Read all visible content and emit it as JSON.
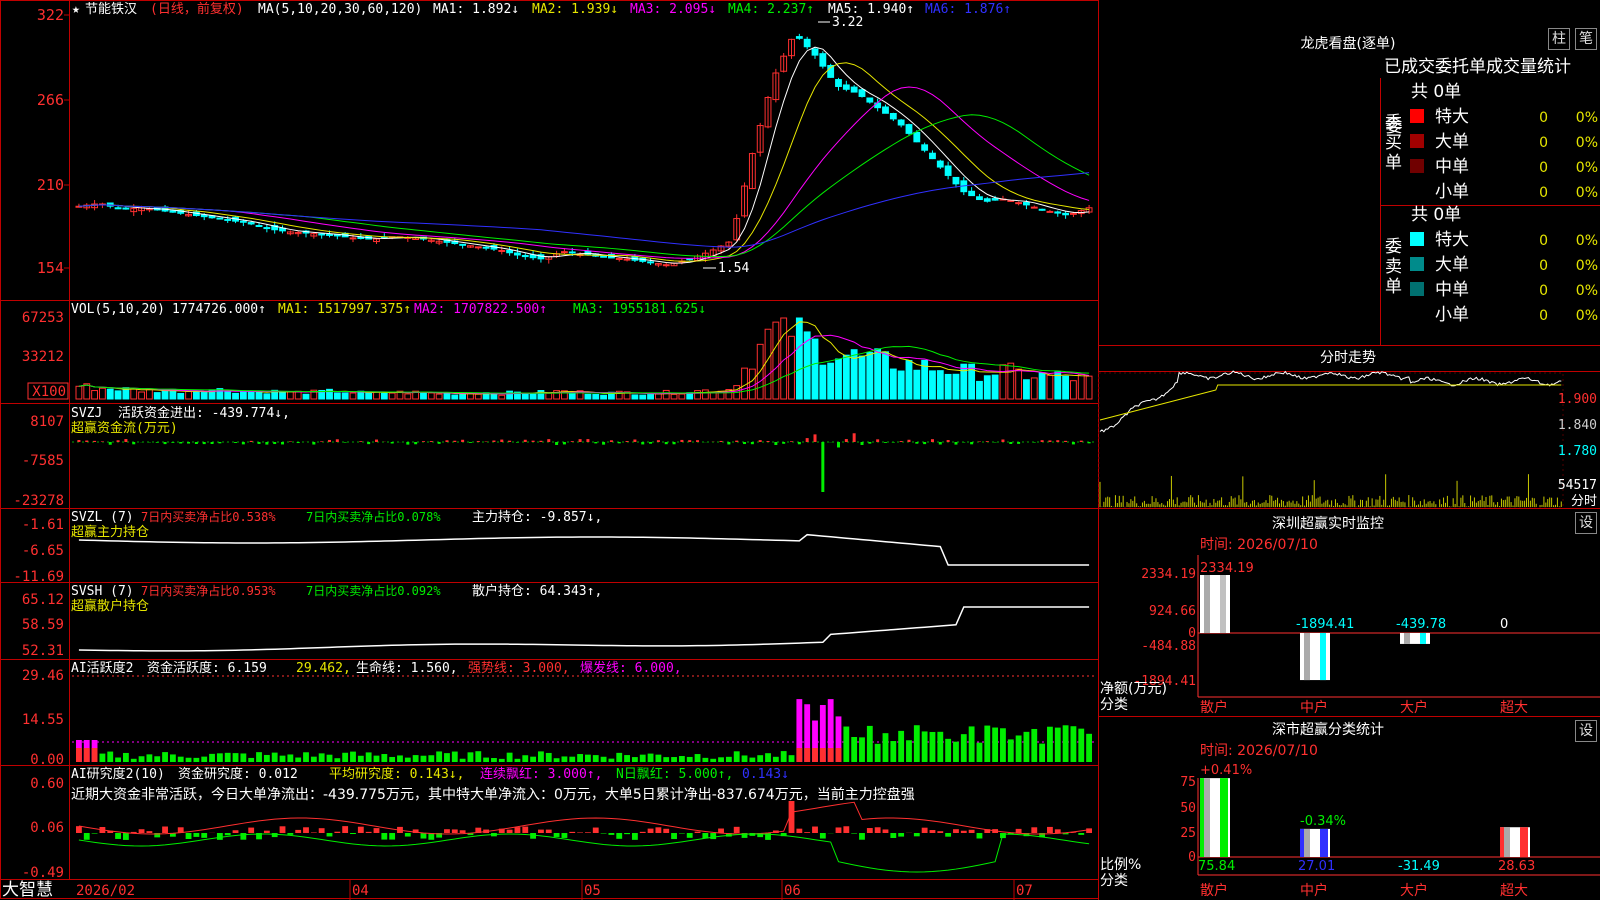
{
  "colors": {
    "up": "#ff3030",
    "down": "#00ffff",
    "green": "#00ee00",
    "magenta": "#ff00ff",
    "yellow": "#e6e600",
    "white": "#ffffff",
    "blue": "#3030ff",
    "red_frame": "#c00000"
  },
  "main": {
    "title_star": "★",
    "title_name": "节能铁汉",
    "title_period": "(日线，前复权)",
    "ma_prefix": "MA(5,10,20,30,60,120)",
    "ma1": "MA1: 1.892↓",
    "ma2": "MA2: 1.939↓",
    "ma3": "MA3: 2.095↓",
    "ma4": "MA4: 2.237↑",
    "ma5": "MA5: 1.940↑",
    "ma6": "MA6: 1.876↑",
    "y_ticks": [
      "322",
      "266",
      "210",
      "154"
    ],
    "high_label": "3.22",
    "low_label": "1.54"
  },
  "vol": {
    "label": "VOL(5,10,20)",
    "value": "1774726.000↑",
    "ma1": "MA1: 1517997.375↑",
    "ma2": "MA2: 1707822.500↑",
    "ma3": "MA3: 1955181.625↓",
    "y_ticks": [
      "67253",
      "33212",
      "X100"
    ]
  },
  "svzj": {
    "label": "SVZJ",
    "line": "活跃资金进出: -439.774↓,",
    "sub": "超赢资金流(万元)",
    "y_ticks": [
      "8107",
      "-7585",
      "-23278"
    ]
  },
  "svzl": {
    "label": "SVZL (7)",
    "a": "7日内买卖净占比0.538%",
    "b": "7日内买卖净占比0.078%",
    "c": "主力持仓: -9.857↓,",
    "sub": "超赢主力持仓",
    "y_ticks": [
      "-1.61",
      "-6.65",
      "-11.69"
    ]
  },
  "svsh": {
    "label": "SVSH (7)",
    "a": "7日内买卖净占比0.953%",
    "b": "7日内买卖净占比0.092%",
    "c": "散户持仓: 64.343↑,",
    "sub": "超赢散户持仓",
    "y_ticks": [
      "65.12",
      "58.59",
      "52.31"
    ]
  },
  "ai2": {
    "label": "AI活跃度2",
    "a": "资金活跃度: 6.159",
    "b": "29.462,",
    "c": "生命线: 1.560,",
    "d": "强势线: 3.000,",
    "e": "爆发线: 6.000,",
    "y_ticks": [
      "29.46",
      "14.55",
      "0.00"
    ]
  },
  "ai_research": {
    "label": "AI研究度2(10)",
    "a": "资金研究度: 0.012",
    "b": "平均研究度: 0.143↓,",
    "c": "连续飘红: 3.000↑,",
    "d": "N日飘红: 5.000↑,",
    "e": "0.143↓",
    "note": "近期大资金非常活跃，今日大单净流出：-439.775万元，其中特大单净流入：0万元，大单5日累计净出-837.674万元，当前主力控盘强",
    "y_ticks": [
      "0.60",
      "0.06",
      "-0.49"
    ]
  },
  "xaxis": {
    "brand": "大智慧",
    "labels": [
      "2026/02",
      "04",
      "05",
      "06",
      "07"
    ]
  },
  "dragon": {
    "title": "龙虎看盘(逐单)",
    "btn_zhu": "柱",
    "btn_bi": "笔",
    "header": "已成交委托单成交量统计",
    "buy_side": "委买单",
    "sell_side": "委卖单",
    "buy_total": "共 0单",
    "sell_total": "共 0单",
    "buy_rows": [
      {
        "name": "特大",
        "count": "0",
        "pct": "0%",
        "color": "#ff0000"
      },
      {
        "name": "大单",
        "count": "0",
        "pct": "0%",
        "color": "#a00000"
      },
      {
        "name": "中单",
        "count": "0",
        "pct": "0%",
        "color": "#700000"
      },
      {
        "name": "小单",
        "count": "0",
        "pct": "0%",
        "color": "#000000"
      }
    ],
    "sell_rows": [
      {
        "name": "特大",
        "count": "0",
        "pct": "0%",
        "color": "#00ffff"
      },
      {
        "name": "大单",
        "count": "0",
        "pct": "0%",
        "color": "#008b8b"
      },
      {
        "name": "中单",
        "count": "0",
        "pct": "0%",
        "color": "#007070"
      },
      {
        "name": "小单",
        "count": "0",
        "pct": "0%",
        "color": "#000000"
      }
    ]
  },
  "intraday": {
    "title": "分时走势",
    "y_ticks": [
      "1.900",
      "1.840",
      "1.780"
    ],
    "vol_label": "54517",
    "unit": "分时"
  },
  "sz_monitor": {
    "title": "深圳超赢实时监控",
    "btn": "设",
    "date": "时间: 2026/07/10",
    "y_ticks": [
      "2334.19",
      "924.66",
      "0",
      "-484.88",
      "-1894.41"
    ],
    "axis_title": "净额(万元)",
    "axis_sub": "分类",
    "categories": [
      "散户",
      "中户",
      "大户",
      "超大"
    ],
    "values": [
      "2334.19",
      "-1894.41",
      "-439.78",
      "0"
    ]
  },
  "sz_stat": {
    "title": "深市超赢分类统计",
    "btn": "设",
    "date": "时间: 2026/07/10",
    "y_ticks": [
      "75",
      "50",
      "25",
      "0"
    ],
    "axis_title": "比例%",
    "axis_sub": "分类",
    "categories": [
      "散户",
      "中户",
      "大户",
      "超大"
    ],
    "top_labels": [
      "+0.41%",
      "-0.34%",
      "",
      ""
    ],
    "values": [
      "75.84",
      "27.01",
      "-31.49",
      "28.63"
    ]
  },
  "chart_data": [
    {
      "type": "candlestick",
      "title": "节能铁汉(日线，前复权)",
      "ylim": [
        1.54,
        3.22
      ],
      "series": [
        {
          "name": "price_close",
          "values": [
            1.95,
            1.97,
            1.93,
            1.94,
            1.92,
            1.9,
            1.88,
            1.86,
            1.84,
            1.8,
            1.78,
            1.77,
            1.76,
            1.74,
            1.73,
            1.75,
            1.74,
            1.72,
            1.7,
            1.68,
            1.66,
            1.62,
            1.6,
            1.65,
            1.63,
            1.61,
            1.6,
            1.58,
            1.56,
            1.6,
            1.65,
            1.72,
            2.3,
            2.8,
            3.1,
            2.95,
            2.75,
            2.7,
            2.6,
            2.5,
            2.35,
            2.2,
            2.05,
            1.98,
            2.0,
            1.96,
            1.92,
            1.89,
            1.94
          ]
        }
      ]
    },
    {
      "type": "bar",
      "title": "VOL(5,10,20)",
      "ylim": [
        0,
        67253
      ],
      "values": [
        12,
        10,
        9,
        8,
        8,
        7,
        9,
        8,
        7,
        7,
        6,
        6,
        7,
        6,
        5,
        6,
        6,
        5,
        5,
        6,
        5,
        6,
        6,
        7,
        6,
        5,
        6,
        5,
        6,
        7,
        8,
        9,
        40,
        62,
        67,
        48,
        42,
        38,
        35,
        33,
        30,
        28,
        25,
        24,
        26,
        22,
        21,
        20,
        18
      ]
    }
  ]
}
